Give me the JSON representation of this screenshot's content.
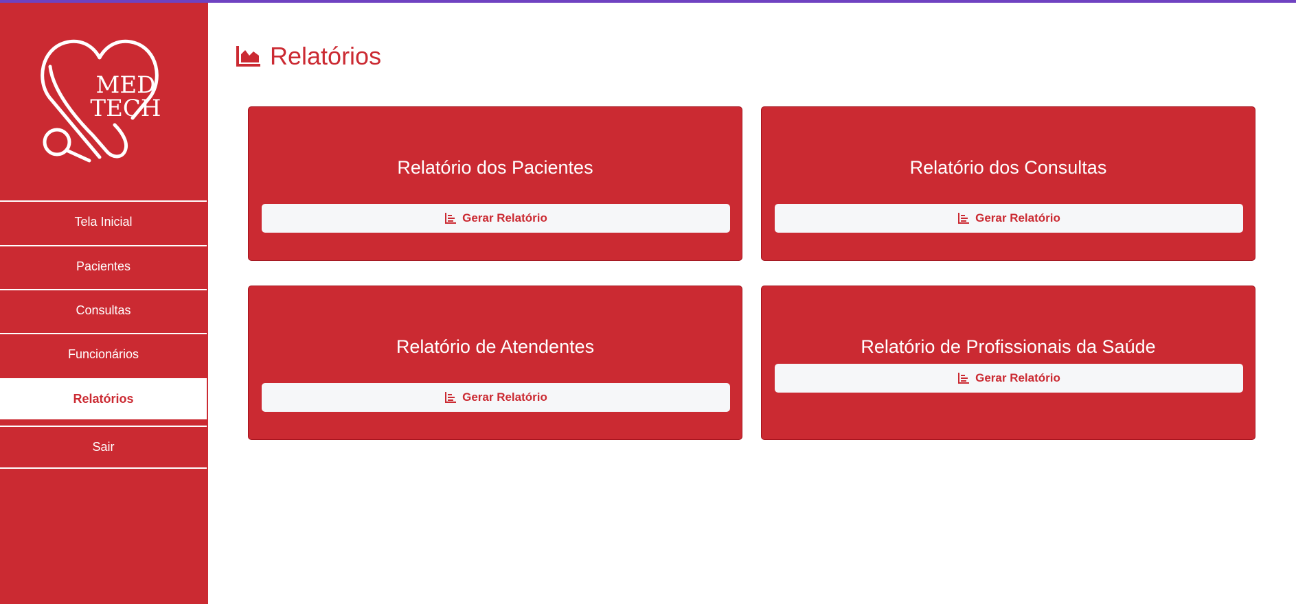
{
  "theme": {
    "accent": "#cb2a32",
    "topbar": "#6f42c1",
    "button_bg": "#f6f7f9"
  },
  "logo": {
    "line1": "MED",
    "line2": "TECH"
  },
  "sidebar": {
    "items": [
      {
        "label": "Tela Inicial",
        "active": false
      },
      {
        "label": "Pacientes",
        "active": false
      },
      {
        "label": "Consultas",
        "active": false
      },
      {
        "label": "Funcionários",
        "active": false
      },
      {
        "label": "Relatórios",
        "active": true
      },
      {
        "label": "Sair",
        "active": false
      }
    ]
  },
  "page": {
    "title": "Relatórios",
    "title_icon": "chart-area-icon"
  },
  "cards": [
    {
      "title": "Relatório dos Pacientes",
      "button_label": "Gerar Relatório",
      "button_icon": "chart-bar-icon"
    },
    {
      "title": "Relatório dos Consultas",
      "button_label": "Gerar Relatório",
      "button_icon": "chart-bar-icon"
    },
    {
      "title": "Relatório de Atendentes",
      "button_label": "Gerar Relatório",
      "button_icon": "chart-bar-icon"
    },
    {
      "title": "Relatório de Profissionais da Saúde",
      "button_label": "Gerar Relatório",
      "button_icon": "chart-bar-icon"
    }
  ]
}
